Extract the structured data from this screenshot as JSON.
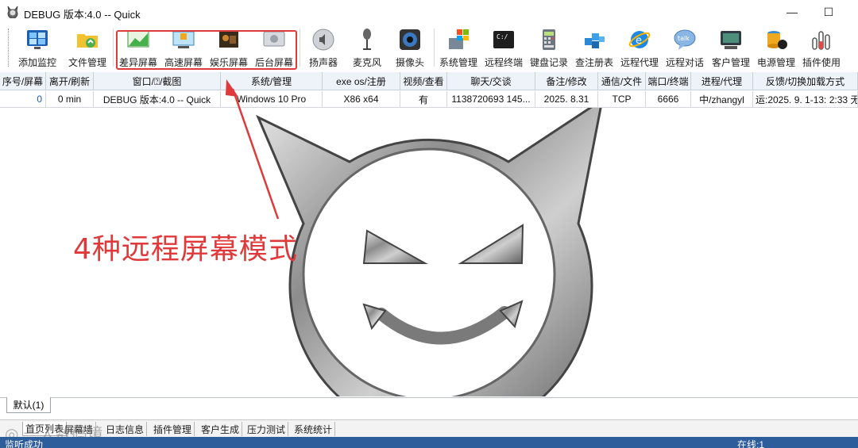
{
  "window": {
    "title": "DEBUG 版本:4.0   -- Quick",
    "minimize": "—",
    "maximize": "☐"
  },
  "toolbar": {
    "items": [
      {
        "label": "添加监控",
        "icon": "add-monitor-icon"
      },
      {
        "label": "文件管理",
        "icon": "file-manager-icon"
      },
      {
        "label": "差异屏幕",
        "icon": "diff-screen-icon"
      },
      {
        "label": "高速屏幕",
        "icon": "fast-screen-icon"
      },
      {
        "label": "娱乐屏幕",
        "icon": "entertainment-screen-icon"
      },
      {
        "label": "后台屏幕",
        "icon": "background-screen-icon"
      },
      {
        "label": "扬声器",
        "icon": "speaker-icon"
      },
      {
        "label": "麦克风",
        "icon": "microphone-icon"
      },
      {
        "label": "摄像头",
        "icon": "camera-icon"
      },
      {
        "label": "系统管理",
        "icon": "system-manage-icon"
      },
      {
        "label": "远程终端",
        "icon": "terminal-icon"
      },
      {
        "label": "键盘记录",
        "icon": "keylog-icon"
      },
      {
        "label": "查注册表",
        "icon": "registry-icon"
      },
      {
        "label": "远程代理",
        "icon": "proxy-icon"
      },
      {
        "label": "远程对话",
        "icon": "chat-icon"
      },
      {
        "label": "客户管理",
        "icon": "client-manage-icon"
      },
      {
        "label": "电源管理",
        "icon": "power-icon"
      },
      {
        "label": "插件使用",
        "icon": "plugin-icon"
      }
    ],
    "highlight_color": "#e03b3b"
  },
  "grid": {
    "headers": [
      "序号/屏幕",
      "离开/刷新",
      "窗口/⍰/截图",
      "系统/管理",
      "exe os/注册",
      "视频/查看",
      "聊天/交谈",
      "备注/修改",
      "通信/文件",
      "端口/终端",
      "进程/代理",
      "反馈/切换加载方式"
    ],
    "rows": [
      [
        "0",
        "0 min",
        "DEBUG 版本:4.0   -- Quick",
        "Windows 10 Pro",
        "X86 x64",
        "有",
        "1138720693 145...",
        "2025. 8.31",
        "TCP",
        "6666",
        "中/zhangyl",
        "运:2025. 9. 1-13: 2:33 无"
      ]
    ]
  },
  "annotation": {
    "text": "4种远程屏幕模式",
    "color": "#e0393b"
  },
  "groups": {
    "default_tab": "默认(1)"
  },
  "bottom_tabs": [
    "首页列表",
    "屏幕墙",
    "日志信息",
    "插件管理",
    "客户生成",
    "压力测试",
    "系统统计"
  ],
  "status": {
    "left": "监听成功",
    "right": "在线:1"
  },
  "watermark": "◎ 一人数码境"
}
